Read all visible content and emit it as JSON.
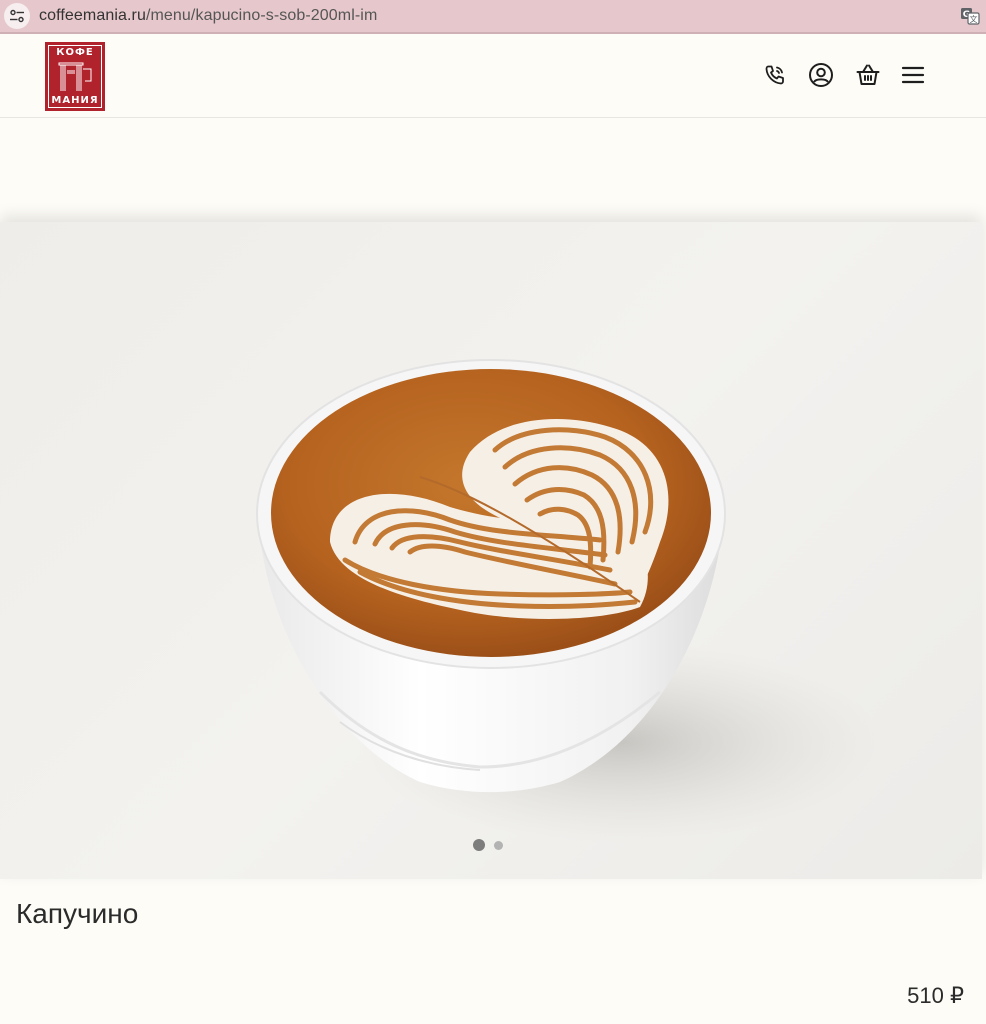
{
  "browser": {
    "url_domain": "coffeemania.ru",
    "url_path": "/menu/kapucino-s-sob-200ml-im"
  },
  "header": {
    "logo": {
      "line1": "КОФЕ",
      "line2": "МАНИЯ"
    },
    "icons": [
      "phone-icon",
      "user-account-icon",
      "basket-icon",
      "menu-hamburger-icon"
    ]
  },
  "product": {
    "title": "Капучино",
    "price": "510 ₽",
    "gallery": {
      "slide_count": 2,
      "active_index": 0
    }
  },
  "colors": {
    "brand_red": "#b0222c",
    "address_bar": "#e6c8cc",
    "page_bg": "#fdfcf7",
    "coffee": "#b8651f"
  }
}
